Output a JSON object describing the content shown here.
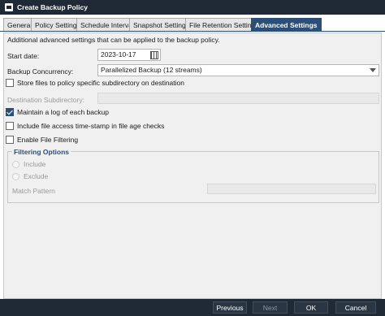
{
  "window": {
    "title": "Create Backup Policy"
  },
  "tabs": [
    {
      "label": "General"
    },
    {
      "label": "Policy Settings"
    },
    {
      "label": "Schedule Interval"
    },
    {
      "label": "Snapshot Settings"
    },
    {
      "label": "File Retention Settings"
    },
    {
      "label": "Advanced Settings",
      "active": true
    }
  ],
  "advanced": {
    "description": "Additional advanced settings that can be applied to the backup policy.",
    "start_date": {
      "label": "Start date:",
      "value": "2023-10-17"
    },
    "concurrency": {
      "label": "Backup Concurrency:",
      "value": "Parallelized Backup (12 streams)"
    },
    "store_files": {
      "label": "Store files to policy specific subdirectory on destination",
      "checked": false
    },
    "destination_subdirectory": {
      "label": "Destination Subdirectory:",
      "value": ""
    },
    "maintain_log": {
      "label": "Maintain a log of each backup",
      "checked": true
    },
    "include_access": {
      "label": "Include file access time-stamp in file age checks",
      "checked": false
    },
    "enable_filtering": {
      "label": "Enable File Filtering",
      "checked": false
    }
  },
  "filtering": {
    "title": "Filtering Options",
    "include_label": "Include",
    "exclude_label": "Exclude",
    "match_pattern_label": "Match Pattern",
    "match_pattern_value": ""
  },
  "footer": {
    "previous": "Previous",
    "next": "Next",
    "ok": "OK",
    "cancel": "Cancel"
  },
  "colors": {
    "titlebar": "#1f2a36",
    "active_tab": "#2c4f78",
    "panel": "#f0f0f0"
  }
}
